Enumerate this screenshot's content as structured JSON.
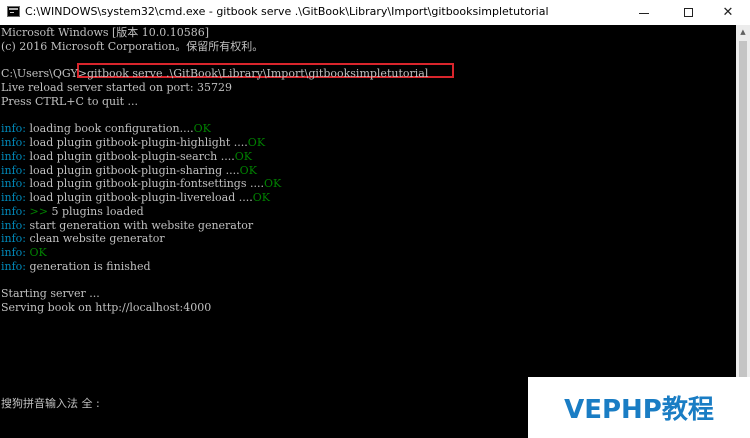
{
  "window": {
    "title": "C:\\WINDOWS\\system32\\cmd.exe - gitbook  serve .\\GitBook\\Library\\Import\\gitbooksimpletutorial",
    "minimize_glyph": "minimize-icon",
    "maximize_glyph": "maximize-icon",
    "close_label": "✕"
  },
  "console": {
    "lines": [
      {
        "segments": [
          {
            "text": "Microsoft Windows [版本 10.0.10586]",
            "style": "plain"
          }
        ]
      },
      {
        "segments": [
          {
            "text": "(c) 2016 Microsoft Corporation。保留所有权利。",
            "style": "plain"
          }
        ]
      },
      {
        "segments": [
          {
            "text": "",
            "style": "plain"
          }
        ]
      },
      {
        "segments": [
          {
            "text": "C:\\Users\\QGY>",
            "style": "plain"
          },
          {
            "text": "gitbook serve .\\GitBook\\Library\\Import\\gitbooksimpletutorial",
            "style": "plain"
          }
        ]
      },
      {
        "segments": [
          {
            "text": "Live reload server started on port: 35729",
            "style": "plain"
          }
        ]
      },
      {
        "segments": [
          {
            "text": "Press CTRL+C to quit ...",
            "style": "plain"
          }
        ]
      },
      {
        "segments": [
          {
            "text": "",
            "style": "plain"
          }
        ]
      },
      {
        "segments": [
          {
            "text": "info:",
            "style": "info"
          },
          {
            "text": " loading book configuration....",
            "style": "plain"
          },
          {
            "text": "OK",
            "style": "ok"
          }
        ]
      },
      {
        "segments": [
          {
            "text": "info:",
            "style": "info"
          },
          {
            "text": " load plugin gitbook-plugin-highlight ....",
            "style": "plain"
          },
          {
            "text": "OK",
            "style": "ok"
          }
        ]
      },
      {
        "segments": [
          {
            "text": "info:",
            "style": "info"
          },
          {
            "text": " load plugin gitbook-plugin-search ....",
            "style": "plain"
          },
          {
            "text": "OK",
            "style": "ok"
          }
        ]
      },
      {
        "segments": [
          {
            "text": "info:",
            "style": "info"
          },
          {
            "text": " load plugin gitbook-plugin-sharing ....",
            "style": "plain"
          },
          {
            "text": "OK",
            "style": "ok"
          }
        ]
      },
      {
        "segments": [
          {
            "text": "info:",
            "style": "info"
          },
          {
            "text": " load plugin gitbook-plugin-fontsettings ....",
            "style": "plain"
          },
          {
            "text": "OK",
            "style": "ok"
          }
        ]
      },
      {
        "segments": [
          {
            "text": "info:",
            "style": "info"
          },
          {
            "text": " load plugin gitbook-plugin-livereload ....",
            "style": "plain"
          },
          {
            "text": "OK",
            "style": "ok"
          }
        ]
      },
      {
        "segments": [
          {
            "text": "info:",
            "style": "info"
          },
          {
            "text": " ",
            "style": "plain"
          },
          {
            "text": ">>",
            "style": "ok"
          },
          {
            "text": " 5 plugins loaded",
            "style": "plain"
          }
        ]
      },
      {
        "segments": [
          {
            "text": "info:",
            "style": "info"
          },
          {
            "text": " start generation with website generator",
            "style": "plain"
          }
        ]
      },
      {
        "segments": [
          {
            "text": "info:",
            "style": "info"
          },
          {
            "text": " clean website generator",
            "style": "plain"
          }
        ]
      },
      {
        "segments": [
          {
            "text": "info:",
            "style": "info"
          },
          {
            "text": " ",
            "style": "plain"
          },
          {
            "text": "OK",
            "style": "ok"
          }
        ]
      },
      {
        "segments": [
          {
            "text": "info:",
            "style": "info"
          },
          {
            "text": " generation is finished",
            "style": "plain"
          }
        ]
      },
      {
        "segments": [
          {
            "text": "",
            "style": "plain"
          }
        ]
      },
      {
        "segments": [
          {
            "text": "Starting server ...",
            "style": "plain"
          }
        ]
      },
      {
        "segments": [
          {
            "text": "Serving book on http://localhost:4000",
            "style": "plain"
          }
        ]
      }
    ]
  },
  "ime": {
    "status": "搜狗拼音输入法 全 :"
  },
  "watermark": {
    "text": "VEPHP教程"
  },
  "colors": {
    "background": "#000000",
    "text": "#c0c0c0",
    "info": "#0088b8",
    "ok": "#008000",
    "highlight_box": "#d9252c",
    "watermark": "#1a7dc4"
  }
}
